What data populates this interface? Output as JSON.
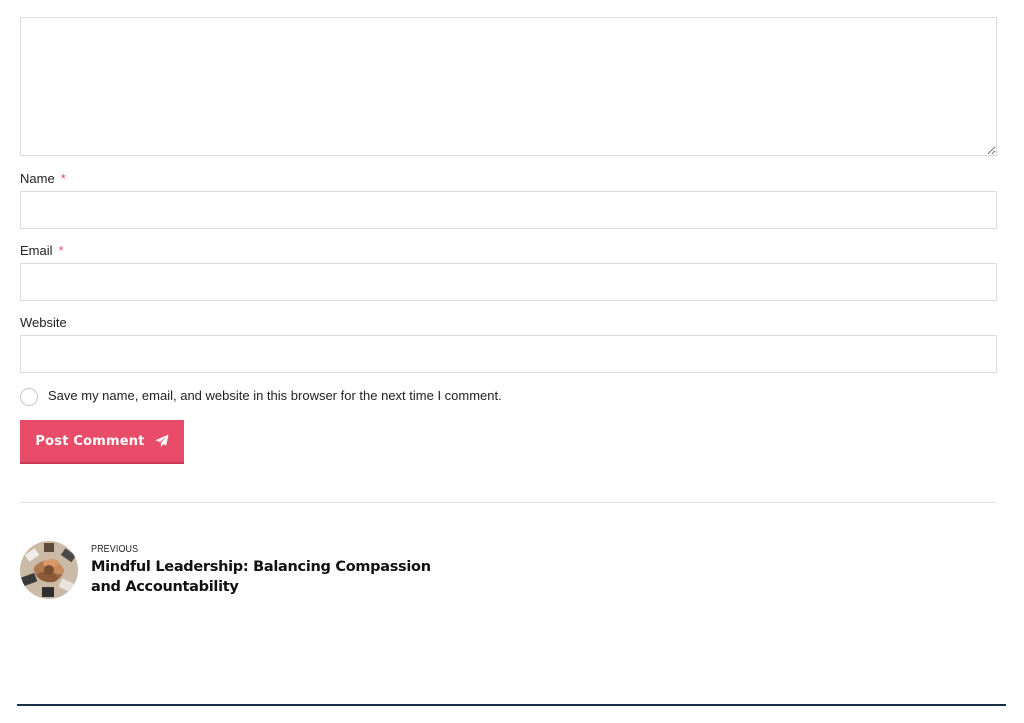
{
  "comment_form": {
    "comment_value": "",
    "name_label": "Name",
    "email_label": "Email",
    "website_label": "Website",
    "required_marker": "*",
    "name_value": "",
    "email_value": "",
    "website_value": "",
    "consent_text": "Save my name, email, and website in this browser for the next time I comment.",
    "consent_checked": false,
    "submit_label": "Post Comment",
    "submit_icon": "paper-plane-icon"
  },
  "post_navigation": {
    "previous": {
      "kicker": "PREVIOUS",
      "title": "Mindful Leadership: Balancing Compassion and Accountability",
      "thumbnail": "team-hands-image"
    }
  },
  "colors": {
    "accent": "#e84c68",
    "border": "#dcdcdc",
    "footer_line": "#17324a",
    "text": "#222222"
  }
}
